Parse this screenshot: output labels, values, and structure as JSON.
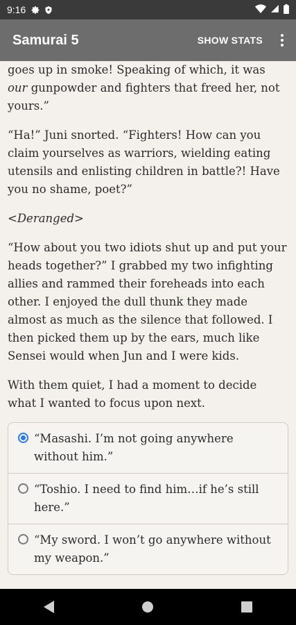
{
  "status_bar": {
    "time": "9:16",
    "icons": [
      "gear-icon",
      "shield-icon",
      "wifi-icon",
      "signal-icon",
      "battery-icon"
    ]
  },
  "app_bar": {
    "title": "Samurai 5",
    "show_stats_label": "SHOW STATS",
    "menu_icon": "more-vert-icon",
    "bar_color": "#6d6d6d"
  },
  "story": {
    "p1_before": "goes up in smoke! Speaking of which, it was ",
    "p1_emph": "our",
    "p1_after": " gunpowder and fighters that freed her, not yours.”",
    "p2": "“Ha!” Juni snorted. “Fighters! How can you claim yourselves as warriors, wielding eating utensils and enlisting children in battle?! Have you no shame, poet?”",
    "p3": "<Deranged>",
    "p4": "“How about you two idiots shut up and put your heads together?” I grabbed my two infighting allies and rammed their foreheads into each other. I enjoyed the dull thunk they made almost as much as the silence that followed. I then picked them up by the ears, much like Sensei would when Jun and I were kids.",
    "p5": "With them quiet, I had a moment to decide what I wanted to focus upon next."
  },
  "choices": [
    {
      "text": "“Masashi. I’m not going anywhere without him.”",
      "selected": true
    },
    {
      "text": "“Toshio. I need to find him…if he’s still here.”",
      "selected": false
    },
    {
      "text": "“My sword. I won’t go anywhere without my weapon.”",
      "selected": false
    }
  ],
  "nav_bar": {
    "icons": [
      "back-icon",
      "home-icon",
      "recents-icon"
    ]
  },
  "colors": {
    "background": "#f4f1ec",
    "accent": "#2979ff"
  }
}
